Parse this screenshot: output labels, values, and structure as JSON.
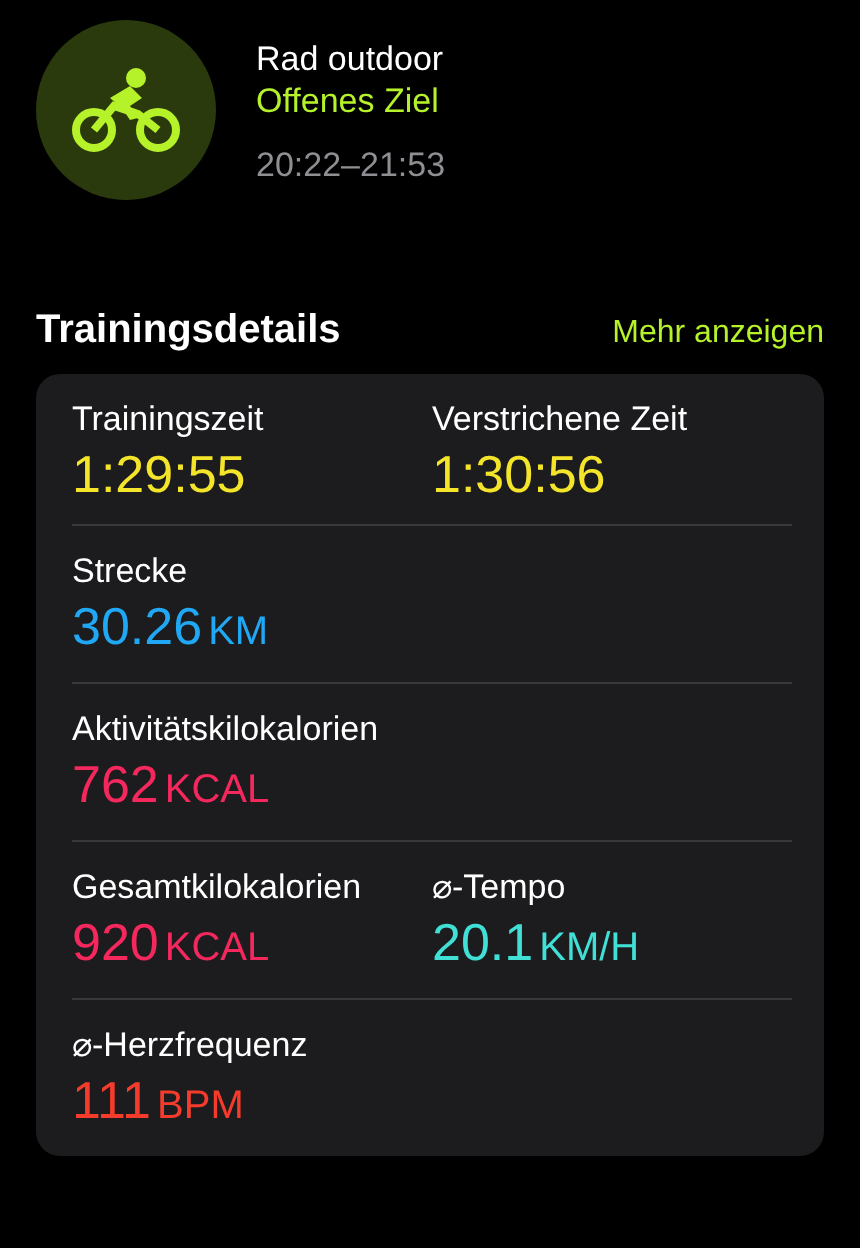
{
  "workout": {
    "title": "Rad outdoor",
    "goal": "Offenes Ziel",
    "time": "20:22–21:53"
  },
  "section": {
    "title": "Trainingsdetails",
    "link": "Mehr anzeigen"
  },
  "rows": [
    {
      "cells": [
        {
          "label": "Trainingszeit",
          "value": "1:29:55",
          "color": "#f4e52b"
        },
        {
          "label": "Verstrichene Zeit",
          "value": "1:30:56",
          "color": "#f4e52b"
        }
      ]
    },
    {
      "cells": [
        {
          "label": "Strecke",
          "value": "30.26",
          "unit": "KM",
          "color": "#20a8f4"
        }
      ]
    },
    {
      "cells": [
        {
          "label": "Aktivitätskilokalorien",
          "value": "762",
          "unit": "KCAL",
          "color": "#f5285e"
        }
      ]
    },
    {
      "cells": [
        {
          "label": "Gesamtkilokalorien",
          "value": "920",
          "unit": "KCAL",
          "color": "#f5285e"
        },
        {
          "label": "⌀-Tempo",
          "value": "20.1",
          "unit": "KM/H",
          "color": "#40e0d6"
        }
      ]
    },
    {
      "cells": [
        {
          "label": "⌀-Herzfrequenz",
          "value": "111",
          "unit": "BPM",
          "color": "#f53c2c"
        }
      ]
    }
  ]
}
